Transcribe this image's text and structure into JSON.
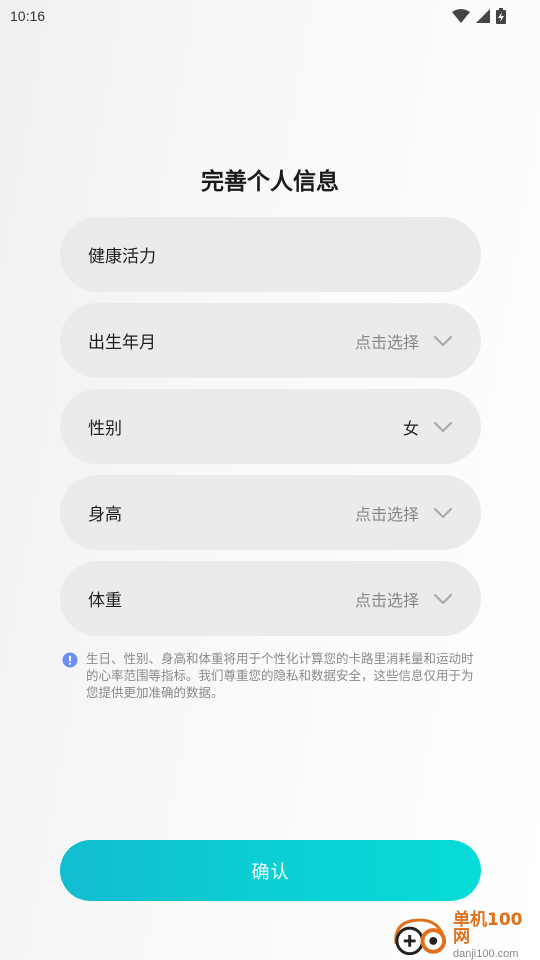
{
  "status_bar": {
    "time": "10:16"
  },
  "title": "完善个人信息",
  "fields": [
    {
      "label": "健康活力",
      "value": "",
      "has_chevron": false
    },
    {
      "label": "出生年月",
      "value": "点击选择",
      "has_chevron": true,
      "selected": false
    },
    {
      "label": "性别",
      "value": "女",
      "has_chevron": true,
      "selected": true
    },
    {
      "label": "身高",
      "value": "点击选择",
      "has_chevron": true,
      "selected": false
    },
    {
      "label": "体重",
      "value": "点击选择",
      "has_chevron": true,
      "selected": false
    }
  ],
  "notice": {
    "icon": "info-icon",
    "text": "生日、性别、身高和体重将用于个性化计算您的卡路里消耗量和运动时的心率范围等指标。我们尊重您的隐私和数据安全，这些信息仅用于为您提供更加准确的数据。"
  },
  "confirm_label": "确认",
  "watermark": {
    "main": "单机100网",
    "sub": "danji100.com"
  },
  "colors": {
    "accent_start": "#12bcd0",
    "accent_end": "#07dcd8",
    "field_bg": "#ebebeb",
    "info_icon": "#6b8ef5",
    "watermark": "#e0701a"
  }
}
